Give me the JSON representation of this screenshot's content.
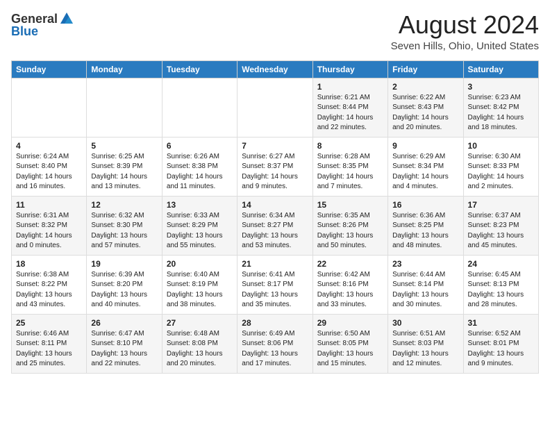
{
  "header": {
    "logo_general": "General",
    "logo_blue": "Blue",
    "title": "August 2024",
    "subtitle": "Seven Hills, Ohio, United States"
  },
  "calendar": {
    "days_of_week": [
      "Sunday",
      "Monday",
      "Tuesday",
      "Wednesday",
      "Thursday",
      "Friday",
      "Saturday"
    ],
    "weeks": [
      [
        {
          "num": "",
          "lines": []
        },
        {
          "num": "",
          "lines": []
        },
        {
          "num": "",
          "lines": []
        },
        {
          "num": "",
          "lines": []
        },
        {
          "num": "1",
          "lines": [
            "Sunrise: 6:21 AM",
            "Sunset: 8:44 PM",
            "Daylight: 14 hours",
            "and 22 minutes."
          ]
        },
        {
          "num": "2",
          "lines": [
            "Sunrise: 6:22 AM",
            "Sunset: 8:43 PM",
            "Daylight: 14 hours",
            "and 20 minutes."
          ]
        },
        {
          "num": "3",
          "lines": [
            "Sunrise: 6:23 AM",
            "Sunset: 8:42 PM",
            "Daylight: 14 hours",
            "and 18 minutes."
          ]
        }
      ],
      [
        {
          "num": "4",
          "lines": [
            "Sunrise: 6:24 AM",
            "Sunset: 8:40 PM",
            "Daylight: 14 hours",
            "and 16 minutes."
          ]
        },
        {
          "num": "5",
          "lines": [
            "Sunrise: 6:25 AM",
            "Sunset: 8:39 PM",
            "Daylight: 14 hours",
            "and 13 minutes."
          ]
        },
        {
          "num": "6",
          "lines": [
            "Sunrise: 6:26 AM",
            "Sunset: 8:38 PM",
            "Daylight: 14 hours",
            "and 11 minutes."
          ]
        },
        {
          "num": "7",
          "lines": [
            "Sunrise: 6:27 AM",
            "Sunset: 8:37 PM",
            "Daylight: 14 hours",
            "and 9 minutes."
          ]
        },
        {
          "num": "8",
          "lines": [
            "Sunrise: 6:28 AM",
            "Sunset: 8:35 PM",
            "Daylight: 14 hours",
            "and 7 minutes."
          ]
        },
        {
          "num": "9",
          "lines": [
            "Sunrise: 6:29 AM",
            "Sunset: 8:34 PM",
            "Daylight: 14 hours",
            "and 4 minutes."
          ]
        },
        {
          "num": "10",
          "lines": [
            "Sunrise: 6:30 AM",
            "Sunset: 8:33 PM",
            "Daylight: 14 hours",
            "and 2 minutes."
          ]
        }
      ],
      [
        {
          "num": "11",
          "lines": [
            "Sunrise: 6:31 AM",
            "Sunset: 8:32 PM",
            "Daylight: 14 hours",
            "and 0 minutes."
          ]
        },
        {
          "num": "12",
          "lines": [
            "Sunrise: 6:32 AM",
            "Sunset: 8:30 PM",
            "Daylight: 13 hours",
            "and 57 minutes."
          ]
        },
        {
          "num": "13",
          "lines": [
            "Sunrise: 6:33 AM",
            "Sunset: 8:29 PM",
            "Daylight: 13 hours",
            "and 55 minutes."
          ]
        },
        {
          "num": "14",
          "lines": [
            "Sunrise: 6:34 AM",
            "Sunset: 8:27 PM",
            "Daylight: 13 hours",
            "and 53 minutes."
          ]
        },
        {
          "num": "15",
          "lines": [
            "Sunrise: 6:35 AM",
            "Sunset: 8:26 PM",
            "Daylight: 13 hours",
            "and 50 minutes."
          ]
        },
        {
          "num": "16",
          "lines": [
            "Sunrise: 6:36 AM",
            "Sunset: 8:25 PM",
            "Daylight: 13 hours",
            "and 48 minutes."
          ]
        },
        {
          "num": "17",
          "lines": [
            "Sunrise: 6:37 AM",
            "Sunset: 8:23 PM",
            "Daylight: 13 hours",
            "and 45 minutes."
          ]
        }
      ],
      [
        {
          "num": "18",
          "lines": [
            "Sunrise: 6:38 AM",
            "Sunset: 8:22 PM",
            "Daylight: 13 hours",
            "and 43 minutes."
          ]
        },
        {
          "num": "19",
          "lines": [
            "Sunrise: 6:39 AM",
            "Sunset: 8:20 PM",
            "Daylight: 13 hours",
            "and 40 minutes."
          ]
        },
        {
          "num": "20",
          "lines": [
            "Sunrise: 6:40 AM",
            "Sunset: 8:19 PM",
            "Daylight: 13 hours",
            "and 38 minutes."
          ]
        },
        {
          "num": "21",
          "lines": [
            "Sunrise: 6:41 AM",
            "Sunset: 8:17 PM",
            "Daylight: 13 hours",
            "and 35 minutes."
          ]
        },
        {
          "num": "22",
          "lines": [
            "Sunrise: 6:42 AM",
            "Sunset: 8:16 PM",
            "Daylight: 13 hours",
            "and 33 minutes."
          ]
        },
        {
          "num": "23",
          "lines": [
            "Sunrise: 6:44 AM",
            "Sunset: 8:14 PM",
            "Daylight: 13 hours",
            "and 30 minutes."
          ]
        },
        {
          "num": "24",
          "lines": [
            "Sunrise: 6:45 AM",
            "Sunset: 8:13 PM",
            "Daylight: 13 hours",
            "and 28 minutes."
          ]
        }
      ],
      [
        {
          "num": "25",
          "lines": [
            "Sunrise: 6:46 AM",
            "Sunset: 8:11 PM",
            "Daylight: 13 hours",
            "and 25 minutes."
          ]
        },
        {
          "num": "26",
          "lines": [
            "Sunrise: 6:47 AM",
            "Sunset: 8:10 PM",
            "Daylight: 13 hours",
            "and 22 minutes."
          ]
        },
        {
          "num": "27",
          "lines": [
            "Sunrise: 6:48 AM",
            "Sunset: 8:08 PM",
            "Daylight: 13 hours",
            "and 20 minutes."
          ]
        },
        {
          "num": "28",
          "lines": [
            "Sunrise: 6:49 AM",
            "Sunset: 8:06 PM",
            "Daylight: 13 hours",
            "and 17 minutes."
          ]
        },
        {
          "num": "29",
          "lines": [
            "Sunrise: 6:50 AM",
            "Sunset: 8:05 PM",
            "Daylight: 13 hours",
            "and 15 minutes."
          ]
        },
        {
          "num": "30",
          "lines": [
            "Sunrise: 6:51 AM",
            "Sunset: 8:03 PM",
            "Daylight: 13 hours",
            "and 12 minutes."
          ]
        },
        {
          "num": "31",
          "lines": [
            "Sunrise: 6:52 AM",
            "Sunset: 8:01 PM",
            "Daylight: 13 hours",
            "and 9 minutes."
          ]
        }
      ]
    ]
  }
}
